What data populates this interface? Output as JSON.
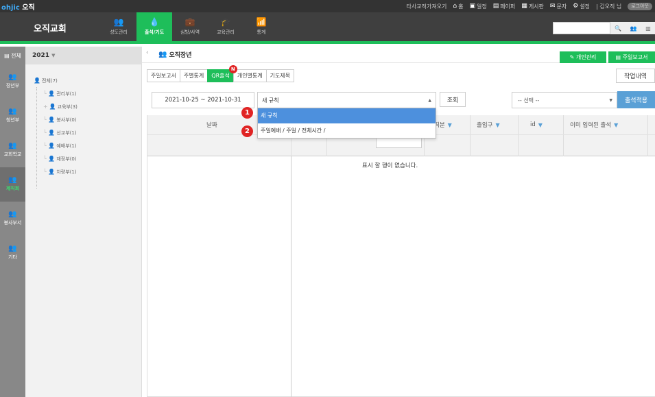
{
  "topbar": {
    "brand_primary": "ohjic",
    "brand_secondary": "오직",
    "links": [
      {
        "icon": "",
        "label": "타사교적가져오기"
      },
      {
        "icon": "⌂",
        "label": "홈"
      },
      {
        "icon": "▣",
        "label": "일정"
      },
      {
        "icon": "▤",
        "label": "페이퍼"
      },
      {
        "icon": "▦",
        "label": "게시판"
      },
      {
        "icon": "✉",
        "label": "문자"
      },
      {
        "icon": "⚙",
        "label": "설정"
      }
    ],
    "user_greeting": "| 김오직 님",
    "logout": "로그아웃"
  },
  "navbar": {
    "church_name": "오직교회",
    "menu": [
      {
        "label": "성도관리",
        "icon": "👥",
        "active": false
      },
      {
        "label": "출석/기도",
        "icon": "💧",
        "active": true
      },
      {
        "label": "심방/사역",
        "icon": "💼",
        "active": false
      },
      {
        "label": "교육관리",
        "icon": "🎓",
        "active": false
      },
      {
        "label": "통계",
        "icon": "📶",
        "active": false
      }
    ],
    "search_placeholder": "",
    "search_icons": [
      "🔍",
      "👥",
      "▥"
    ]
  },
  "iconcol": {
    "first": "▤ 전체",
    "items": [
      {
        "label": "장년부",
        "active": false
      },
      {
        "label": "청년부",
        "active": false
      },
      {
        "label": "교회학교",
        "active": false
      },
      {
        "label": "제직회",
        "active": true
      },
      {
        "label": "봉사부서",
        "active": false
      },
      {
        "label": "기타",
        "active": false
      }
    ]
  },
  "tree": {
    "year": "2021",
    "root": "전체(7)",
    "children": [
      {
        "label": "관리부(1)",
        "prefix": ""
      },
      {
        "label": "교육부(3)",
        "prefix": "+"
      },
      {
        "label": "봉사부(0)",
        "prefix": ""
      },
      {
        "label": "선교부(1)",
        "prefix": ""
      },
      {
        "label": "예배부(1)",
        "prefix": ""
      },
      {
        "label": "재정부(0)",
        "prefix": ""
      },
      {
        "label": "차량부(1)",
        "prefix": ""
      }
    ]
  },
  "content": {
    "title": "오직장년",
    "btn_personal": "✎ 개인관리",
    "btn_weekly": "▤ 주일보고서",
    "tabs": [
      {
        "label": "주일보고서",
        "active": false
      },
      {
        "label": "주별통계",
        "active": false
      },
      {
        "label": "QR출석",
        "active": true,
        "badge": "N"
      },
      {
        "label": "개인별통계",
        "active": false
      },
      {
        "label": "기도제목",
        "active": false
      }
    ],
    "work_btn": "작업내역",
    "date_range": "2021-10-25 ~ 2021-10-31",
    "rule_selected": "새 규칙",
    "query_btn": "조회",
    "select2": "-- 선택 --",
    "apply_btn": "출석적용",
    "columns": [
      "날짜",
      "직분",
      "출입구",
      "id",
      "이미 입력된 출석"
    ],
    "empty_text": "표시 할 행이 없습니다.",
    "dropdown_options": [
      "새 규칙",
      "주일예배 / 주일 / 전체시간 /"
    ],
    "markers": [
      "1",
      "2"
    ]
  },
  "colors": {
    "accent_green": "#1ebe5a",
    "select_blue": "#4d90dd",
    "apply_blue": "#5aa0d6",
    "marker_red": "#e02424"
  }
}
